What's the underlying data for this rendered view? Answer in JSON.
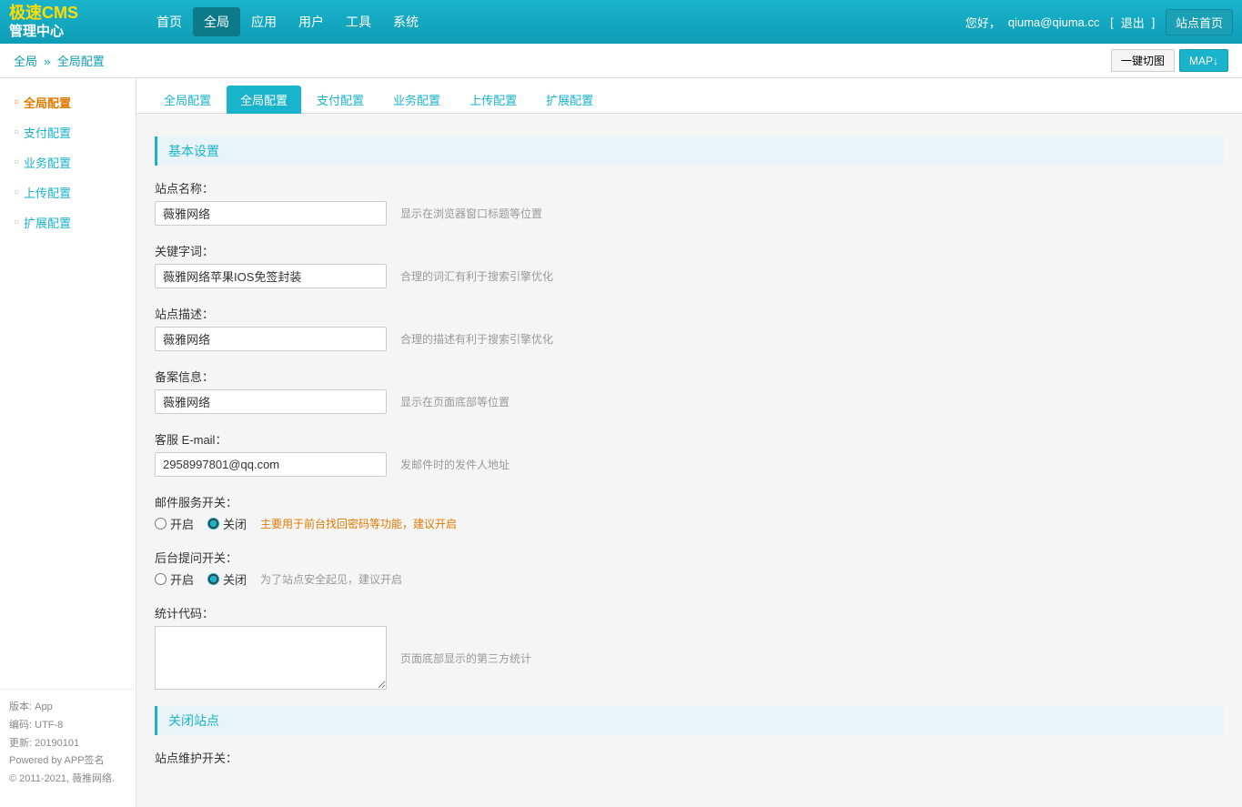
{
  "header": {
    "logo_line1": "极速CMS",
    "logo_line2": "管理中心",
    "nav": [
      {
        "label": "首页",
        "active": false
      },
      {
        "label": "全局",
        "active": true
      },
      {
        "label": "应用",
        "active": false
      },
      {
        "label": "用户",
        "active": false
      },
      {
        "label": "工具",
        "active": false
      },
      {
        "label": "系统",
        "active": false
      }
    ],
    "user_greeting": "您好，",
    "username": "qiuma@qiuma.cc",
    "logout": "退出",
    "site_home": "站点首页"
  },
  "breadcrumb": {
    "root": "全局",
    "separator": "»",
    "current": "全局配置",
    "btn_yijian": "一键切图",
    "btn_map": "MAP↓"
  },
  "sidebar": {
    "items": [
      {
        "label": "全局配置",
        "active": true
      },
      {
        "label": "支付配置",
        "active": false
      },
      {
        "label": "业务配置",
        "active": false
      },
      {
        "label": "上传配置",
        "active": false
      },
      {
        "label": "扩展配置",
        "active": false
      }
    ],
    "footer": {
      "version_label": "版本:",
      "version_value": "App",
      "encoding_label": "编码:",
      "encoding_value": "UTF-8",
      "update_label": "更新:",
      "update_value": "20190101",
      "powered_by": "Powered by APP签名",
      "copyright": "© 2011-2021, 薇推网络."
    }
  },
  "tabs": [
    {
      "label": "全局配置",
      "active": false
    },
    {
      "label": "全局配置",
      "active": true
    },
    {
      "label": "支付配置",
      "active": false
    },
    {
      "label": "业务配置",
      "active": false
    },
    {
      "label": "上传配置",
      "active": false
    },
    {
      "label": "扩展配置",
      "active": false
    }
  ],
  "form": {
    "section_basic": "基本设置",
    "fields": [
      {
        "label": "站点名称：",
        "value": "薇雅网络",
        "hint": "显示在浏览器窗口标题等位置",
        "type": "text",
        "width": "short"
      },
      {
        "label": "关键字词：",
        "value": "薇雅网络苹果IOS免签封装",
        "hint": "合理的词汇有利于搜索引擎优化",
        "type": "text",
        "width": "medium"
      },
      {
        "label": "站点描述：",
        "value": "薇雅网络",
        "hint": "合理的描述有利于搜索引擎优化",
        "type": "text",
        "width": "short"
      },
      {
        "label": "备案信息：",
        "value": "薇雅网络",
        "hint": "显示在页面底部等位置",
        "type": "text",
        "width": "short"
      },
      {
        "label": "客服 E-mail：",
        "value": "2958997801@qq.com",
        "hint": "发邮件时的发件人地址",
        "type": "text",
        "width": "email"
      }
    ],
    "mail_switch": {
      "label": "邮件服务开关：",
      "options": [
        "开启",
        "关闭"
      ],
      "selected": "关闭",
      "hint": "主要用于前台找回密码等功能，建议开启",
      "hint_link": "建议开启"
    },
    "backend_switch": {
      "label": "后台提问开关：",
      "options": [
        "开启",
        "关闭"
      ],
      "selected": "关闭",
      "hint": "为了站点安全起见，建议开启"
    },
    "stats_code": {
      "label": "统计代码：",
      "value": "",
      "hint": "页面底部显示的第三方统计"
    },
    "section_close": "关闭站点",
    "site_maintain": {
      "label": "站点维护开关："
    }
  }
}
